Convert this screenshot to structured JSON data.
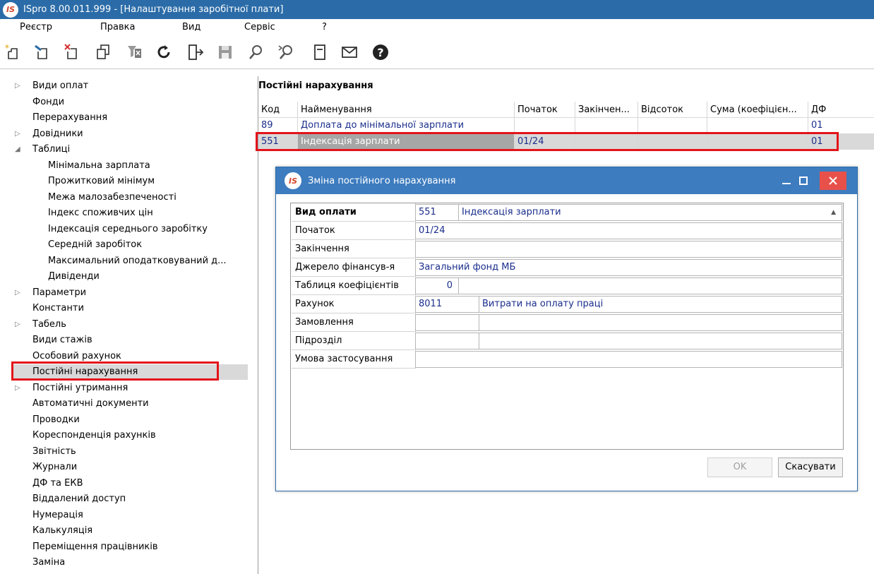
{
  "app": {
    "title": "ISpro 8.00.011.999 - [Налаштування заробітної плати]",
    "logo_text": "IS"
  },
  "menu": [
    "Реєстр",
    "Правка",
    "Вид",
    "Сервіс",
    "?"
  ],
  "toolbar": [
    "new-doc-icon",
    "edit-doc-icon",
    "delete-doc-icon",
    "copy-icon",
    "clear-filter-icon",
    "refresh-icon",
    "exit-icon",
    "save-icon",
    "search-icon",
    "find-next-icon",
    "form-icon",
    "mail-icon",
    "help-icon"
  ],
  "tree": [
    {
      "label": "Види оплат",
      "expand": "▷",
      "level": 0
    },
    {
      "label": "Фонди",
      "expand": "",
      "level": 0
    },
    {
      "label": "Перерахування",
      "expand": "",
      "level": 0
    },
    {
      "label": "Довідники",
      "expand": "▷",
      "level": 0
    },
    {
      "label": "Таблиці",
      "expand": "◢",
      "level": 0
    },
    {
      "label": "Мінімальна зарплата",
      "expand": "",
      "level": 1
    },
    {
      "label": "Прожитковий мінімум",
      "expand": "",
      "level": 1
    },
    {
      "label": "Межа малозабезпеченості",
      "expand": "",
      "level": 1
    },
    {
      "label": "Індекс споживчих цін",
      "expand": "",
      "level": 1
    },
    {
      "label": "Індексація середнього заробітку",
      "expand": "",
      "level": 1
    },
    {
      "label": "Середній заробіток",
      "expand": "",
      "level": 1
    },
    {
      "label": "Максимальний оподатковуваний д...",
      "expand": "",
      "level": 1
    },
    {
      "label": "Дивіденди",
      "expand": "",
      "level": 1
    },
    {
      "label": "Параметри",
      "expand": "▷",
      "level": 0
    },
    {
      "label": "Константи",
      "expand": "",
      "level": 0
    },
    {
      "label": "Табель",
      "expand": "▷",
      "level": 0
    },
    {
      "label": "Види стажів",
      "expand": "",
      "level": 0
    },
    {
      "label": "Особовий рахунок",
      "expand": "",
      "level": 0
    },
    {
      "label": "Постійні нарахування",
      "expand": "",
      "level": 0,
      "selected": true
    },
    {
      "label": "Постійні утримання",
      "expand": "▷",
      "level": 0
    },
    {
      "label": "Автоматичні документи",
      "expand": "",
      "level": 0
    },
    {
      "label": "Проводки",
      "expand": "",
      "level": 0
    },
    {
      "label": "Кореспонденція рахунків",
      "expand": "",
      "level": 0
    },
    {
      "label": "Звітність",
      "expand": "",
      "level": 0
    },
    {
      "label": "Журнали",
      "expand": "",
      "level": 0
    },
    {
      "label": "ДФ та ЕКВ",
      "expand": "",
      "level": 0
    },
    {
      "label": "Віддалений доступ",
      "expand": "",
      "level": 0
    },
    {
      "label": "Нумерація",
      "expand": "",
      "level": 0
    },
    {
      "label": "Калькуляція",
      "expand": "",
      "level": 0
    },
    {
      "label": "Переміщення працівників",
      "expand": "",
      "level": 0
    },
    {
      "label": "Заміна",
      "expand": "",
      "level": 0
    }
  ],
  "main": {
    "section_title": "Постійні нарахування",
    "columns": [
      "Код",
      "Найменування",
      "Початок",
      "Закінчен...",
      "Відсоток",
      "Сума (коефіцієн...",
      "ДФ"
    ],
    "rows": [
      [
        "89",
        "Доплата до мінімальної  зарплати",
        "",
        "",
        "",
        "",
        "01"
      ],
      [
        "551",
        "Індексація зарплати",
        "01/24",
        "",
        "",
        "",
        "01"
      ]
    ]
  },
  "dialog": {
    "title": "Зміна постійного нарахування",
    "fields": {
      "vid_oplaty_label": "Вид оплати",
      "vid_oplaty_code": "551",
      "vid_oplaty_name": "Індексація зарплати",
      "pochatok_label": "Початок",
      "pochatok_value": "01/24",
      "zakinchennia_label": "Закінчення",
      "zakinchennia_value": "",
      "dzherelo_label": "Джерело фінансув-я",
      "dzherelo_value": "Загальний фонд МБ",
      "tablytsia_label": "Таблиця коефіцієнтів",
      "tablytsia_value": "0",
      "tablytsia_extra": "",
      "rakhunok_label": "Рахунок",
      "rakhunok_code": "8011",
      "rakhunok_name": "Витрати на оплату праці",
      "zamovlennia_label": "Замовлення",
      "zamovlennia_code": "",
      "zamovlennia_name": "",
      "pidrozdil_label": "Підрозділ",
      "pidrozdil_code": "",
      "pidrozdil_name": "",
      "umova_label": "Умова застосування",
      "umova_value": ""
    },
    "ok_label": "OK",
    "cancel_label": "Скасувати"
  },
  "colors": {
    "titlebar": "#2b6ca8",
    "dialog_titlebar": "#3d7cbf",
    "highlight": "#e3141b",
    "value_text": "#1a2e8c"
  }
}
